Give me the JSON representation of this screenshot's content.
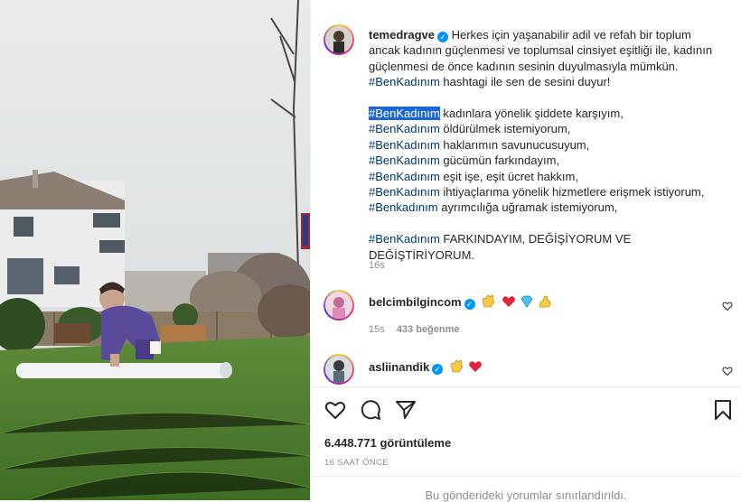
{
  "post": {
    "author": "temedragve",
    "caption_lines": [
      "Herkes için yaşanabilir adil ve refah bir toplum",
      "ancak kadının güçlenmesi ve toplumsal cinsiyet eşitliği ile, kadının",
      "güçlenmesi de önce kadının sesinin duyulmasıyla mümkün."
    ],
    "hashtag_line": {
      "tag": "#BenKadınım",
      "rest": " hashtagi ile sen de sesini duyur!"
    },
    "statements": [
      {
        "tag": "#BenKadınım",
        "rest": " kadınlara yönelik şiddete karşıyım,"
      },
      {
        "tag": "#BenKadınım",
        "rest": " öldürülmek istemiyorum,"
      },
      {
        "tag": "#BenKadınım",
        "rest": " haklarımın savunucusuyum,"
      },
      {
        "tag": "#BenKadınım",
        "rest": " gücümün farkındayım,"
      },
      {
        "tag": "#BenKadınım",
        "rest": " eşit işe, eşit ücret hakkım,"
      },
      {
        "tag": "#BenKadınım",
        "rest": " ihtiyaçlarıma yönelik hizmetlere erişmek istiyorum,"
      },
      {
        "tag": "#Benkadınım",
        "rest": " ayrımcılığa uğramak istemiyorum,"
      }
    ],
    "final_line": {
      "tag": "#BenKadınım",
      "rest": " FARKINDAYIM, DEĞİŞİYORUM VE DEĞİŞTİRİYORUM."
    },
    "time": "16s"
  },
  "comments": [
    {
      "author": "belcimbilgincom",
      "emojis": [
        "clap-emoji",
        "heart-emoji",
        "gem-emoji",
        "muscle-emoji"
      ],
      "time": "15s",
      "likes": "433 beğenme"
    },
    {
      "author": "asliinandik",
      "emojis": [
        "clap-emoji",
        "heart-emoji"
      ]
    }
  ],
  "footer": {
    "views": "6.448.771 görüntüleme",
    "date": "16 SAAT ÖNCE",
    "comments_notice": "Bu gönderideki yorumlar sınırlandırıldı."
  },
  "colors": {
    "link": "#00376b",
    "verified": "#0095f6",
    "highlight": "#1a66d6",
    "heart": "#ed4956"
  }
}
